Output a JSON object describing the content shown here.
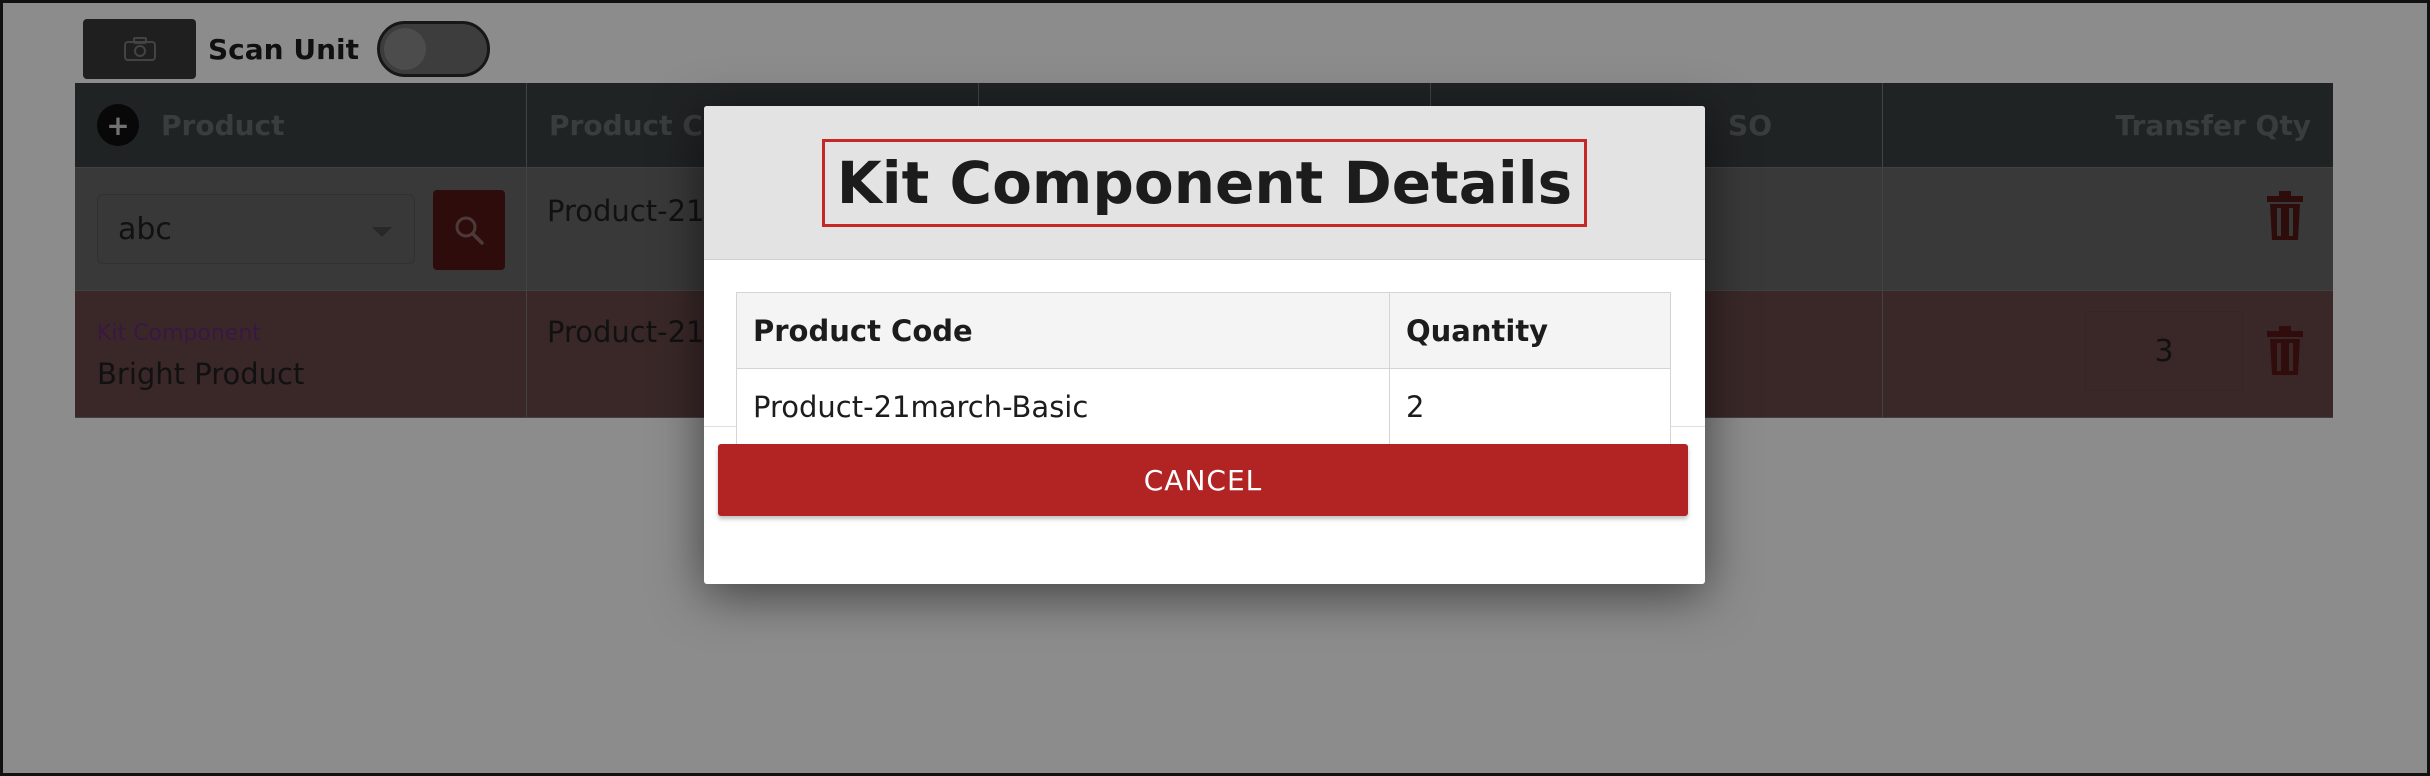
{
  "toolbar": {
    "scan_label": "Scan Unit",
    "camera_icon": "camera-icon",
    "scan_toggle_on": false
  },
  "table": {
    "headers": {
      "product": "Product",
      "product_code": "Product Co",
      "col3": "",
      "col4": "SO",
      "transfer_qty": "Transfer Qty"
    },
    "row1": {
      "select_value": "abc",
      "product_code": "Product-21r"
    },
    "row2": {
      "kit_label": "Kit Component",
      "product_name": "Bright Product",
      "product_code": "Product-21r",
      "qty": "3"
    }
  },
  "modal": {
    "title": "Kit Component Details",
    "columns": [
      "Product Code",
      "Quantity"
    ],
    "rows": [
      [
        "Product-21march-Basic",
        "2"
      ]
    ],
    "cancel_label": "CANCEL"
  },
  "colors": {
    "accent_red": "#b22323",
    "title_outline": "#c62828",
    "kit_label": "#9b3fb0"
  }
}
